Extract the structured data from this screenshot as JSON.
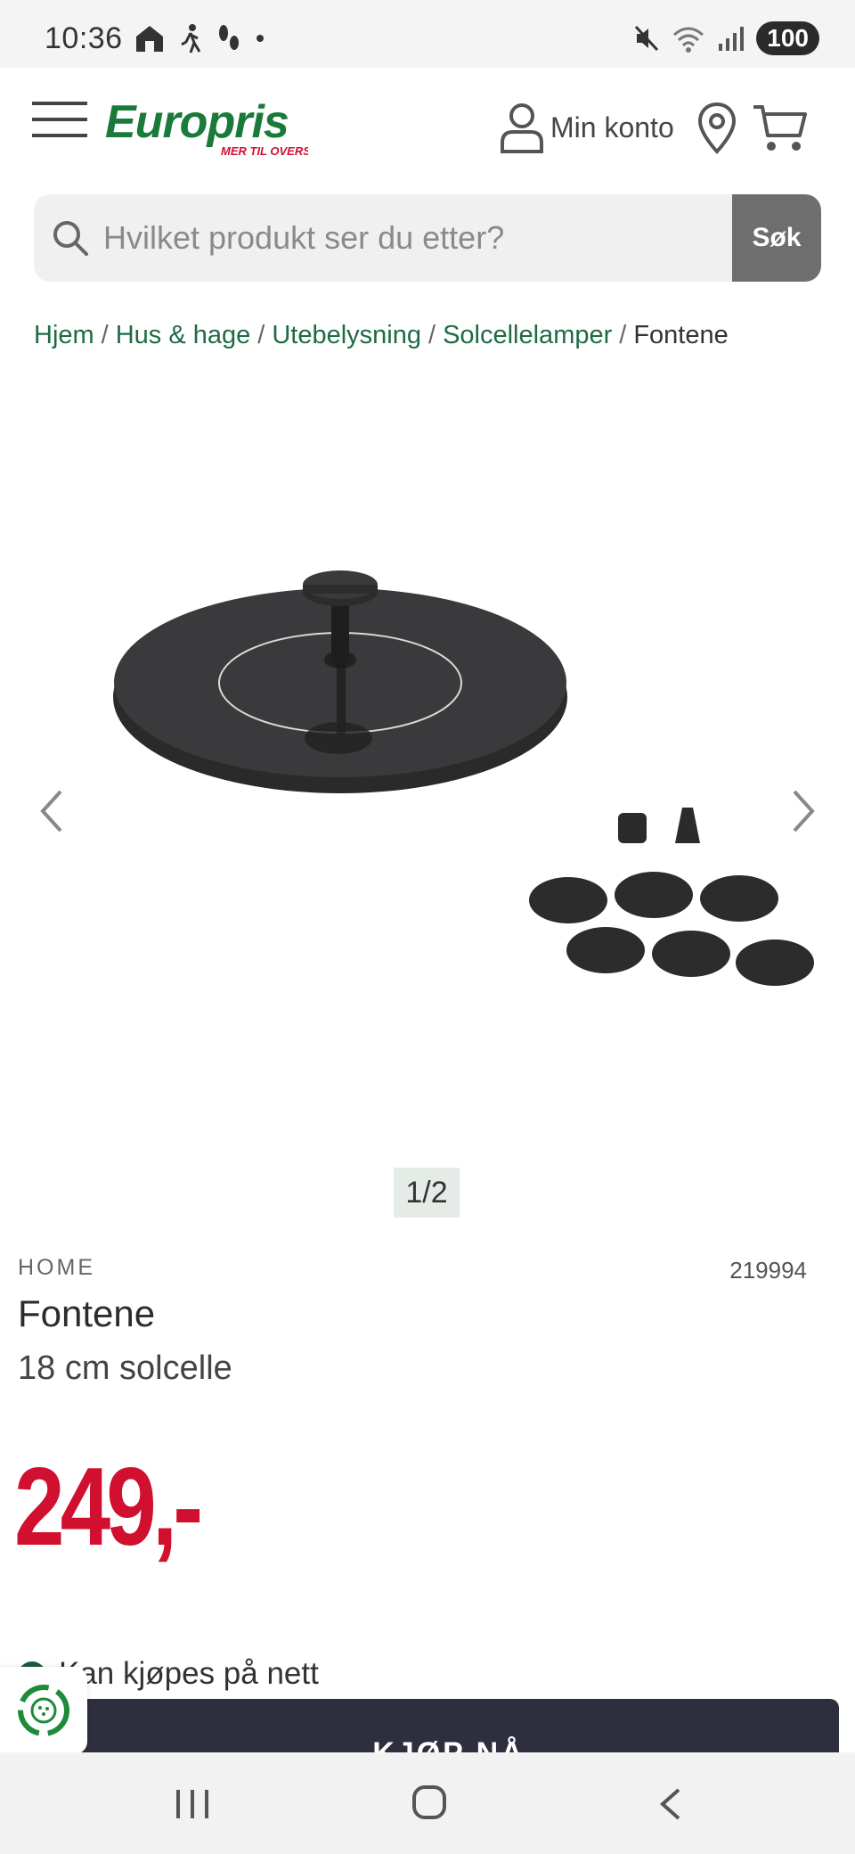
{
  "status_bar": {
    "time": "10:36",
    "battery": "100",
    "left_icons": [
      "home-icon",
      "walking-icon",
      "footsteps-icon",
      "dot-icon"
    ],
    "right_icons": [
      "mute-icon",
      "wifi-icon",
      "signal-icon",
      "battery-icon"
    ]
  },
  "header": {
    "logo_text": "Europris",
    "logo_tagline": "MER TIL OVERS",
    "account_label": "Min konto"
  },
  "search": {
    "placeholder": "Hvilket produkt ser du etter?",
    "button_label": "Søk"
  },
  "breadcrumb": {
    "items": [
      "Hjem",
      "Hus & hage",
      "Utebelysning",
      "Solcellelamper"
    ],
    "current": "Fontene",
    "separator": "/"
  },
  "gallery": {
    "counter": "1/2"
  },
  "product": {
    "brand": "HOME",
    "sku": "219994",
    "title": "Fontene",
    "subtitle": "18 cm solcelle",
    "price": "249,-",
    "availability": "Kan kjøpes på nett",
    "buy_label": "KJØP NÅ"
  },
  "colors": {
    "brand_green": "#1e6b45",
    "price_red": "#d0102e",
    "buy_button": "#2e2f3e"
  }
}
